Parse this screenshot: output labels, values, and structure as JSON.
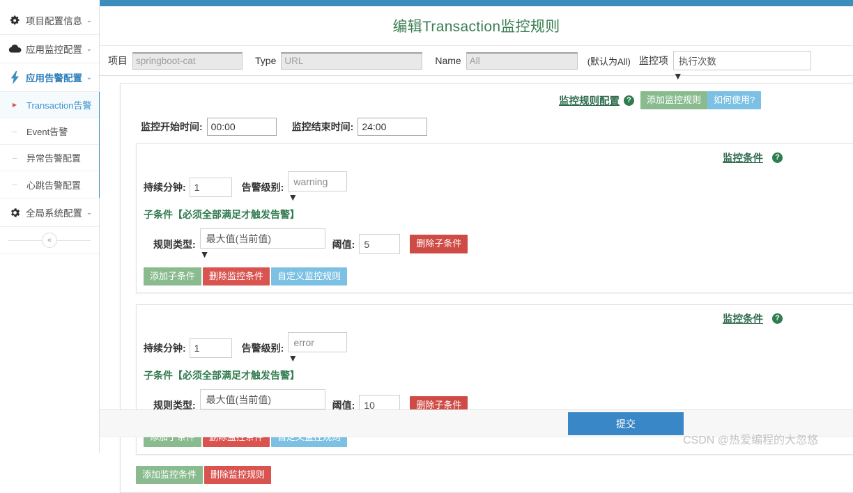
{
  "topbar": {
    "color": "#3c8dbc"
  },
  "sidebar": {
    "groups": [
      {
        "icon": "gears-icon",
        "label": "项目配置信息",
        "caret": "⌄",
        "active": false
      },
      {
        "icon": "cloud-icon",
        "label": "应用监控配置",
        "caret": "⌄",
        "active": false
      },
      {
        "icon": "bolt-icon",
        "label": "应用告警配置",
        "caret": "⌄",
        "active": true
      }
    ],
    "sub_items": [
      {
        "label": "Transaction告警",
        "selected": true
      },
      {
        "label": "Event告警",
        "selected": false
      },
      {
        "label": "异常告警配置",
        "selected": false
      },
      {
        "label": "心跳告警配置",
        "selected": false
      }
    ],
    "global_group": {
      "icon": "gear-icon",
      "label": "全局系统配置",
      "caret": "⌄"
    },
    "collapse_label": "«"
  },
  "header": {
    "title": "编辑Transaction监控规则",
    "title_color": "#3a7d52"
  },
  "filter": {
    "project_label": "项目",
    "project_value": "springboot-cat",
    "type_label": "Type",
    "type_value": "URL",
    "name_label": "Name",
    "name_value": "All",
    "note": "(默认为All)",
    "monitor_item_label": "监控项",
    "monitor_item_value": "执行次数",
    "select_arrow": "▼"
  },
  "rule_config": {
    "title": "监控规则配置",
    "help_glyph": "?",
    "add_rule_label": "添加监控规则",
    "how_to_use_label": "如何使用?",
    "start_time_label": "监控开始时间:",
    "start_time_value": "00:00",
    "end_time_label": "监控结束时间:",
    "end_time_value": "24:00",
    "add_condition_label": "添加监控条件",
    "delete_rule_label": "删除监控规则"
  },
  "conditions": [
    {
      "title": "监控条件",
      "help_glyph": "?",
      "duration_label": "持续分钟:",
      "duration_value": "1",
      "level_label": "告警级别:",
      "level_value": "warning",
      "subcond_note": "子条件【必须全部满足才触发告警】",
      "rule_type_label": "规则类型:",
      "rule_type_value": "最大值(当前值)",
      "threshold_label": "阈值:",
      "threshold_value": "5",
      "delete_sub_label": "删除子条件",
      "add_sub_label": "添加子条件",
      "delete_cond_label": "删除监控条件",
      "custom_rule_label": "自定义监控规则",
      "select_arrow": "▼"
    },
    {
      "title": "监控条件",
      "help_glyph": "?",
      "duration_label": "持续分钟:",
      "duration_value": "1",
      "level_label": "告警级别:",
      "level_value": "error",
      "subcond_note": "子条件【必须全部满足才触发告警】",
      "rule_type_label": "规则类型:",
      "rule_type_value": "最大值(当前值)",
      "threshold_label": "阈值:",
      "threshold_value": "10",
      "delete_sub_label": "删除子条件",
      "add_sub_label": "添加子条件",
      "delete_cond_label": "删除监控条件",
      "custom_rule_label": "自定义监控规则",
      "select_arrow": "▼"
    }
  ],
  "footer": {
    "submit_label": "提交",
    "watermark": "CSDN @热爱编程的大忽悠"
  }
}
